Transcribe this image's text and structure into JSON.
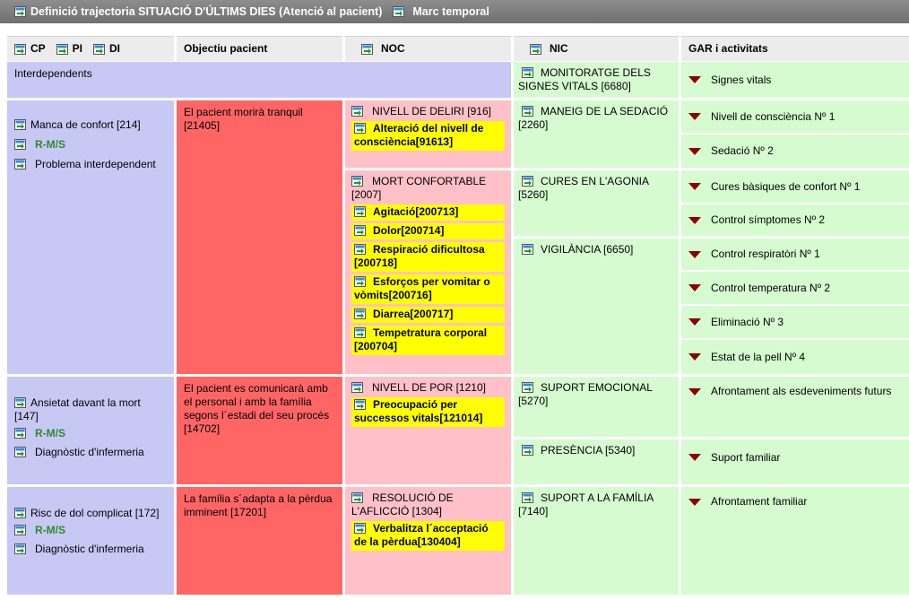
{
  "titlebar": {
    "title": "Definició trajectoria SITUACIÓ D'ÚLTIMS DIES (Atenció al pacient)",
    "marc": "Marc temporal"
  },
  "headers": {
    "cp": "CP",
    "pi": "PI",
    "di": "DI",
    "objectiu": "Objectiu pacient",
    "noc": "NOC",
    "nic": "NIC",
    "gar": "GAR i activitats"
  },
  "interdependents": {
    "label": "Interdependents",
    "nic": "MONITORATGE DELS SIGNES VITALS [6680]",
    "gar": "Signes vitals"
  },
  "row1": {
    "cp_name": "Manca de confort [214]",
    "cp_tag": "R-M/S",
    "cp_type": "Problema interdependent",
    "objectiu": "El pacient morirà tranquil [21405]",
    "noc1": "NIVELL DE DELIRI [916]",
    "noc1_items": [
      "Alteració del nivell de consciència[91613]"
    ],
    "noc2": "MORT CONFORTABLE [2007]",
    "noc2_items": [
      "Agitació[200713]",
      "Dolor[200714]",
      "Respiració dificultosa [200718]",
      "Esforços per vomitar o vòmits[200716]",
      "Diarrea[200717]",
      "Tempetratura corporal [200704]"
    ],
    "nic1": "MANEIG DE LA SEDACIÓ [2260]",
    "nic2": "CURES EN L'AGONIA [5260]",
    "nic3": "VIGILÀNCIA [6650]",
    "gar": [
      "Nivell de consciència Nº 1",
      "Sedació Nº 2",
      "Cures bàsiques de confort Nº 1",
      "Control símptomes Nº 2",
      "Control respiratòri Nº 1",
      "Control temperatura Nº 2",
      "Eliminació Nº 3",
      "Estat de la pell Nº 4"
    ]
  },
  "row2": {
    "cp_name": "Ansietat davant la mort [147]",
    "cp_tag": "R-M/S",
    "cp_type": "Diagnòstic d'infermeria",
    "objectiu": "El pacient es comunicarà amb el personal i amb la família segons l´estadi del seu procés [14702]",
    "noc": "NIVELL DE POR [1210]",
    "noc_items": [
      "Preocupació per successos vitals[121014]"
    ],
    "nic1": "SUPORT EMOCIONAL [5270]",
    "nic2": "PRESÈNCIA [5340]",
    "gar1": "Afrontament als esdeveniments futurs",
    "gar2": "Suport familiar"
  },
  "row3": {
    "cp_name": "Risc de dol complicat [172]",
    "cp_tag": "R-M/S",
    "cp_type": "Diagnòstic d'infermeria",
    "objectiu": "La família s´adapta a la pèrdua imminent [17201]",
    "noc": "RESOLUCIÓ DE L'AFLICCIÓ [1304]",
    "noc_items": [
      "Verbalitza l´acceptació de la pèrdua[130404]"
    ],
    "nic": "SUPORT A LA FAMÍLIA [7140]",
    "gar": "Afrontament familiar"
  }
}
